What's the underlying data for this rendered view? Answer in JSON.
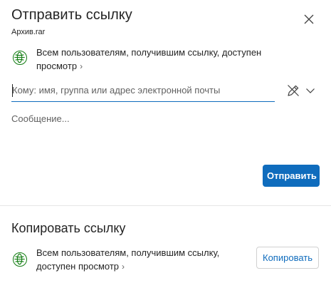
{
  "send_section": {
    "title": "Отправить ссылку",
    "file_name": "Архив.rar",
    "close_icon": "close-icon",
    "permission_text": "Всем пользователям, получившим ссылку, доступен просмотр",
    "to_placeholder": "Кому: имя, группа или адрес электронной почты",
    "message_placeholder": "Сообщение...",
    "send_label": "Отправить",
    "edit_icon": "pencil-icon",
    "dropdown_icon": "chevron-down-icon"
  },
  "copy_section": {
    "title": "Копировать ссылку",
    "permission_text": "Всем пользователям, получившим ссылку, доступен просмотр",
    "copy_label": "Копировать"
  },
  "colors": {
    "accent": "#0f6cbd",
    "globe": "#107c10",
    "text": "#242424",
    "muted": "#616161",
    "divider": "#e6e6e6"
  }
}
